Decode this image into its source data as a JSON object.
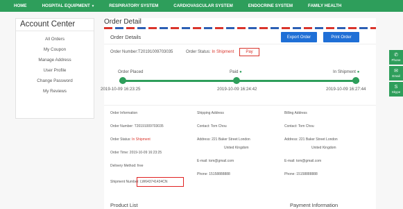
{
  "nav": {
    "items": [
      "HOME",
      "HOSPITAL EQUIPMENT",
      "RESPIRATORY SYSTEM",
      "CARDIOVASCULAR SYSTEM",
      "ENDOCRINE SYSTEM",
      "FAMILY HEALTH"
    ]
  },
  "sidebar": {
    "title": "Account Center",
    "items": [
      "All Orders",
      "My Coupon",
      "Manage Address",
      "User Profile",
      "Change Password",
      "My Reviews"
    ]
  },
  "page": {
    "title": "Order Detail",
    "section_title": "Order Details",
    "export_label": "Export Order",
    "print_label": "Print Order"
  },
  "order": {
    "number_line": "Order Number:T20191009703035",
    "status_label": "Order Status:",
    "status_value": "In Shipment",
    "pay_label": "Pay"
  },
  "progress": {
    "steps": [
      {
        "label": "Order Placed",
        "time": "2019-10-09 16:23:25"
      },
      {
        "label": "Paid",
        "time": "2019-10-09 16:24:42"
      },
      {
        "label": "In Shipment",
        "time": "2019-10-09 16:27:44"
      }
    ]
  },
  "info": {
    "order": {
      "heading": "Order Information",
      "number": "Order Number: T20191009703035",
      "status_label": "Order Status:",
      "status_value": "In Shipment",
      "time": "Order Time: 2019-10-09 16:23:25",
      "delivery": "Delivery Method: free",
      "shipment": "Shipment Number: LW643741434CN"
    },
    "shipping": {
      "heading": "Shipping Address",
      "contact": "Contact: Tom Chou",
      "address1": "Address: 221 Baker Street London",
      "address2": "United Kingdom",
      "email": "E-mail: tom@gmail.com",
      "phone": "Phone: 15158888888"
    },
    "billing": {
      "heading": "Billing Address",
      "contact": "Contact: Tom Chou",
      "address1": "Address: 221 Baker Street London",
      "address2": "United Kingdom",
      "email": "E-mail: tom@gmail.com",
      "phone": "Phone: 15158888888"
    }
  },
  "bottom": {
    "product_list": "Product List",
    "payment_info": "Payment Information"
  },
  "side_tabs": [
    {
      "icon": "phone-icon",
      "label": "Phone"
    },
    {
      "icon": "email-icon",
      "label": "Email"
    },
    {
      "icon": "skype-icon",
      "label": "Skype"
    }
  ],
  "colors": {
    "brand_green": "#2e9e5b",
    "button_blue": "#1f6fd6",
    "status_red": "#d9342b"
  }
}
